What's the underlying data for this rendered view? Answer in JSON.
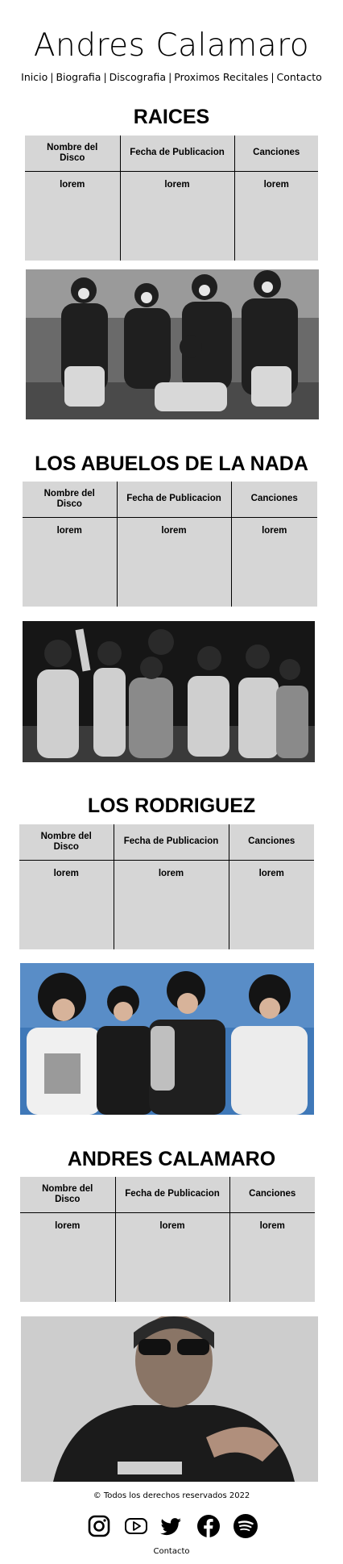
{
  "header": {
    "title": "Andres Calamaro",
    "nav": [
      {
        "label": "Inicio"
      },
      {
        "label": "Biografia"
      },
      {
        "label": "Discografia"
      },
      {
        "label": "Proximos Recitales"
      },
      {
        "label": "Contacto"
      }
    ],
    "separator": "|"
  },
  "sections": [
    {
      "title": "RAICES",
      "columns": [
        "Nombre del Disco",
        "Fecha de Publicacion",
        "Canciones"
      ],
      "row": [
        "lorem",
        "lorem",
        "lorem"
      ]
    },
    {
      "title": "LOS ABUELOS DE LA NADA",
      "columns": [
        "Nombre del Disco",
        "Fecha de Publicacion",
        "Canciones"
      ],
      "row": [
        "lorem",
        "lorem",
        "lorem"
      ]
    },
    {
      "title": "LOS RODRIGUEZ",
      "columns": [
        "Nombre del Disco",
        "Fecha de Publicacion",
        "Canciones"
      ],
      "row": [
        "lorem",
        "lorem",
        "lorem"
      ]
    },
    {
      "title": "ANDRES CALAMARO",
      "columns": [
        "Nombre del Disco",
        "Fecha de Publicacion",
        "Canciones"
      ],
      "row": [
        "lorem",
        "lorem",
        "lorem"
      ]
    }
  ],
  "footer": {
    "copyright": "© Todos los derechos reservados 2022",
    "socials": [
      {
        "icon": "instagram-icon"
      },
      {
        "icon": "youtube-icon"
      },
      {
        "icon": "twitter-icon"
      },
      {
        "icon": "facebook-icon"
      },
      {
        "icon": "spotify-icon"
      }
    ],
    "contact_label": "Contacto"
  },
  "colors": {
    "table_bg": "#d6d6d6",
    "text": "#000000",
    "background": "#ffffff"
  }
}
